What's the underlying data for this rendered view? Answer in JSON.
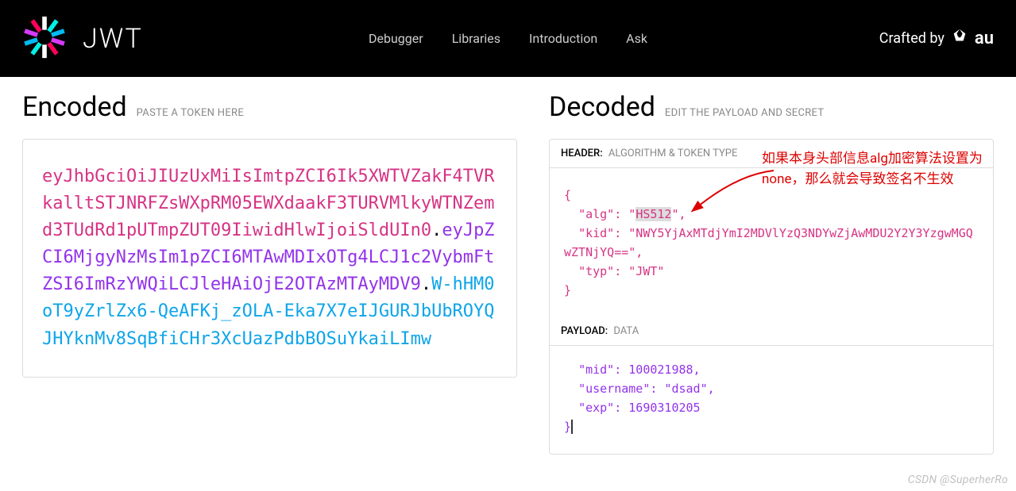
{
  "header": {
    "logo_text": "JWT",
    "nav": {
      "debugger": "Debugger",
      "libraries": "Libraries",
      "introduction": "Introduction",
      "ask": "Ask"
    },
    "crafted_by": "Crafted by",
    "brand": "au"
  },
  "encoded": {
    "title": "Encoded",
    "subtitle": "PASTE A TOKEN HERE",
    "token_header": "eyJhbGciOiJIUzUxMiIsImtpZCI6Ik5XWTVZakF4TVRkalltSTJNRFZsWXpRM05EWXdaakF3TURVMlkyWTNZemd3TUdRd1pUTmpZUT09IiwidHlwIjoiSldUIn0",
    "token_payload": "eyJpZCI6MjgyNzMsIm1pZCI6MTAwMDIxOTg4LCJ1c2VybmFtZSI6ImRzYWQiLCJleHAiOjE2OTAzMTAyMDV9",
    "token_signature": "W-hHM0oT9yZrlZx6-QeAFKj_zOLA-Eka7X7eIJGURJbUbROYQJHYknMv8SqBfiCHr3XcUazPdbBOSuYkaiLImw",
    "dot": "."
  },
  "decoded": {
    "title": "Decoded",
    "subtitle": "EDIT THE PAYLOAD AND SECRET",
    "header_panel": {
      "label": "HEADER:",
      "sublabel": "ALGORITHM & TOKEN TYPE",
      "open_brace": "{",
      "alg_key": "\"alg\": ",
      "alg_val_open": "\"",
      "alg_val": "HS512",
      "alg_val_close": "\",",
      "kid_line": "\"kid\": \"NWY5YjAxMTdjYmI2MDVlYzQ3NDYwZjAwMDU2Y2Y3YzgwMGQwZTNjYQ==\",",
      "typ_line": "\"typ\": \"JWT\"",
      "close_brace": "}"
    },
    "payload_panel": {
      "label": "PAYLOAD:",
      "sublabel": "DATA",
      "mid_line": "\"mid\": 100021988,",
      "username_line": "\"username\": \"dsad\",",
      "exp_line": "\"exp\": 1690310205",
      "close_brace": "}"
    }
  },
  "annotation": {
    "text": "如果本身头部信息alg加密算法设置为none，那么就会导致签名不生效"
  },
  "watermark": "CSDN @SuperherRo"
}
